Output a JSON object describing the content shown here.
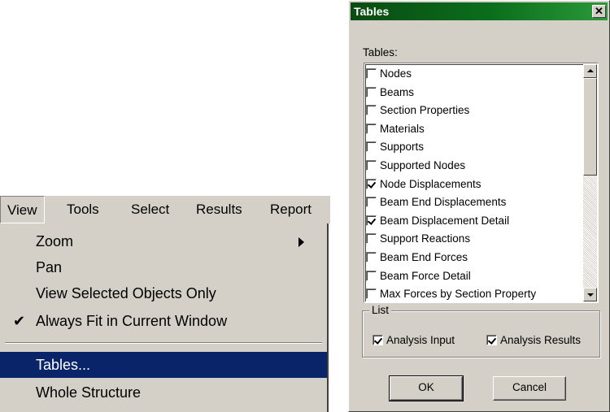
{
  "menubar": {
    "items": [
      "View",
      "Tools",
      "Select",
      "Results",
      "Report"
    ]
  },
  "view_menu": {
    "items": [
      {
        "label": "Zoom",
        "submenu": true
      },
      {
        "label": "Pan"
      },
      {
        "label": "View Selected Objects Only"
      },
      {
        "label": "Always Fit in Current Window",
        "checked": true
      },
      {
        "label": "Tables...",
        "highlighted": true
      },
      {
        "label": "Whole Structure"
      }
    ],
    "check_glyph": "✔"
  },
  "dialog": {
    "title": "Tables",
    "close_glyph": "✕",
    "tables_label": "Tables:",
    "tables": [
      {
        "label": "Nodes",
        "checked": false
      },
      {
        "label": "Beams",
        "checked": false
      },
      {
        "label": "Section Properties",
        "checked": false
      },
      {
        "label": "Materials",
        "checked": false
      },
      {
        "label": "Supports",
        "checked": false
      },
      {
        "label": "Supported Nodes",
        "checked": false
      },
      {
        "label": "Node Displacements",
        "checked": true
      },
      {
        "label": "Beam End Displacements",
        "checked": false
      },
      {
        "label": "Beam Displacement Detail",
        "checked": true
      },
      {
        "label": "Support Reactions",
        "checked": false
      },
      {
        "label": "Beam End Forces",
        "checked": false
      },
      {
        "label": "Beam Force Detail",
        "checked": false
      },
      {
        "label": "Max Forces by Section Property",
        "checked": false
      }
    ],
    "list_group": {
      "title": "List",
      "analysis_input": {
        "label": "Analysis Input",
        "checked": true
      },
      "analysis_results": {
        "label": "Analysis Results",
        "checked": true
      }
    },
    "ok_label": "OK",
    "cancel_label": "Cancel"
  },
  "colors": {
    "menu_face": "#d4d0c8",
    "highlight": "#0a246a",
    "titlebar_start": "#0a4b12",
    "titlebar_end": "#2a9a3a"
  }
}
